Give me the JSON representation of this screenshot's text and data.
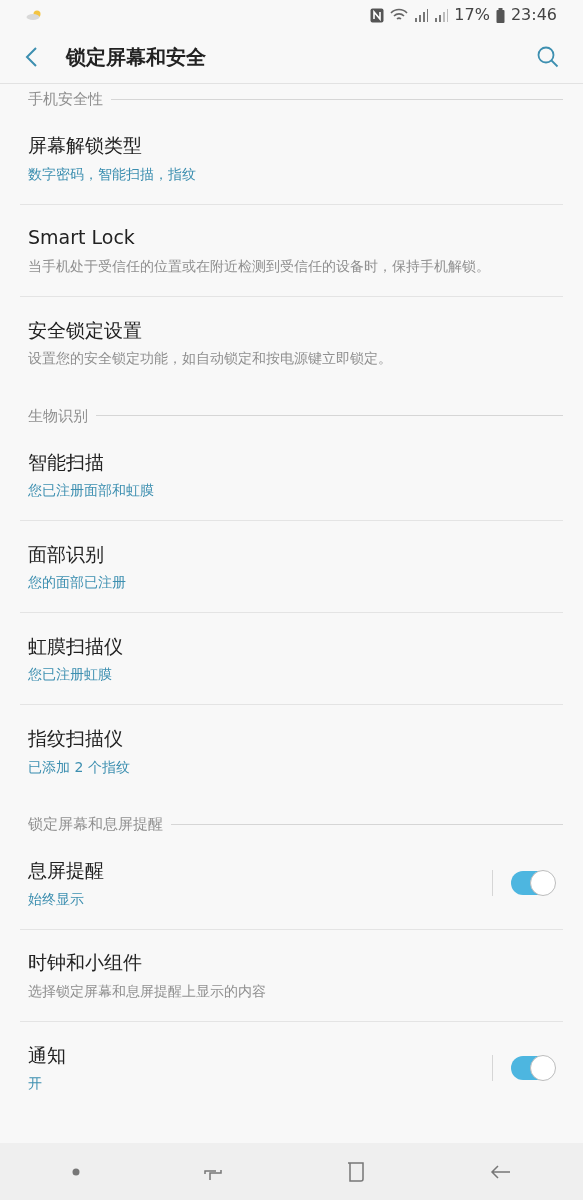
{
  "status_bar": {
    "battery": "17%",
    "time": "23:46"
  },
  "header": {
    "title": "锁定屏幕和安全"
  },
  "sections": [
    {
      "title": "手机安全性",
      "items": [
        {
          "title": "屏幕解锁类型",
          "subtitle": "数字密码，智能扫描，指纹",
          "kind": "value"
        },
        {
          "title": "Smart Lock",
          "subtitle": "当手机处于受信任的位置或在附近检测到受信任的设备时，保持手机解锁。",
          "kind": "description"
        },
        {
          "title": "安全锁定设置",
          "subtitle": "设置您的安全锁定功能，如自动锁定和按电源键立即锁定。",
          "kind": "description"
        }
      ]
    },
    {
      "title": "生物识别",
      "items": [
        {
          "title": "智能扫描",
          "subtitle": "您已注册面部和虹膜",
          "kind": "value"
        },
        {
          "title": "面部识别",
          "subtitle": "您的面部已注册",
          "kind": "value"
        },
        {
          "title": "虹膜扫描仪",
          "subtitle": "您已注册虹膜",
          "kind": "value"
        },
        {
          "title": "指纹扫描仪",
          "subtitle": "已添加 2 个指纹",
          "kind": "value"
        }
      ]
    },
    {
      "title": "锁定屏幕和息屏提醒",
      "items": [
        {
          "title": "息屏提醒",
          "subtitle": "始终显示",
          "kind": "value",
          "switch": {
            "on": true
          }
        },
        {
          "title": "时钟和小组件",
          "subtitle": "选择锁定屏幕和息屏提醒上显示的内容",
          "kind": "description"
        },
        {
          "title": "通知",
          "subtitle": "开",
          "kind": "value",
          "switch": {
            "on": true
          }
        }
      ]
    }
  ]
}
